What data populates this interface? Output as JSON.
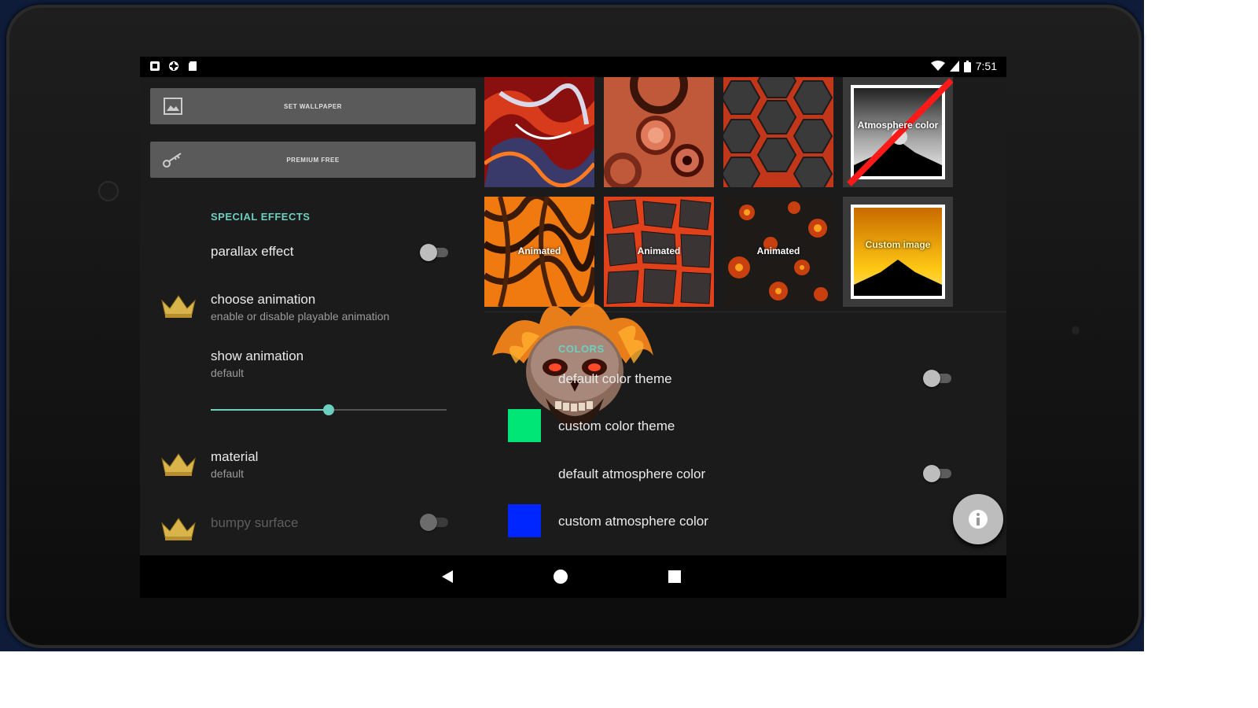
{
  "status_bar": {
    "left_icons": [
      "photo-icon",
      "android-icon",
      "sd-card-icon"
    ],
    "right_icons": [
      "wifi-icon",
      "signal-icon",
      "battery-icon"
    ],
    "time": "7:51"
  },
  "left_panel": {
    "buttons": [
      {
        "label": "SET WALLPAPER",
        "icon": "image-icon"
      },
      {
        "label": "PREMIUM FREE",
        "icon": "key-icon"
      }
    ],
    "section_title": "SPECIAL EFFECTS",
    "parallax": {
      "title": "parallax effect",
      "enabled": false
    },
    "choose_animation": {
      "title": "choose animation",
      "summary": "enable or disable playable animation",
      "premium": true
    },
    "show_animation": {
      "title": "show animation",
      "summary": "default",
      "slider_value": 0.5
    },
    "material": {
      "title": "material",
      "summary": "default",
      "premium": true
    },
    "bumpy_surface": {
      "title": "bumpy surface",
      "enabled": false,
      "premium": true
    }
  },
  "texture_grid": {
    "tiles": [
      {
        "label": "",
        "name": "texture-red-liquid-metal"
      },
      {
        "label": "",
        "name": "texture-copper-rings"
      },
      {
        "label": "",
        "name": "texture-hex-lava"
      },
      {
        "label": "Atmosphere color",
        "name": "texture-atmosphere-color"
      },
      {
        "label": "Animated",
        "name": "texture-animated-orange-lava"
      },
      {
        "label": "Animated",
        "name": "texture-animated-lava-rock"
      },
      {
        "label": "Animated",
        "name": "texture-animated-ember"
      },
      {
        "label": "Custom image",
        "name": "texture-custom-image"
      }
    ]
  },
  "colors_panel": {
    "section_title": "COLORS",
    "default_color_theme": {
      "title": "default color theme",
      "enabled": false
    },
    "custom_color_theme": {
      "title": "custom color theme",
      "color": "#00e676"
    },
    "default_atmosphere_color": {
      "title": "default atmosphere color",
      "enabled": false
    },
    "custom_atmosphere_color": {
      "title": "custom atmosphere color",
      "color": "#0026ff"
    }
  },
  "fab": {
    "icon": "info-icon"
  },
  "nav_bar": {
    "buttons": [
      "back-icon",
      "home-icon",
      "recents-icon"
    ]
  },
  "colors": {
    "accent": "#6dcfc0",
    "background": "#1b1b1b",
    "button": "#5a5a5a"
  }
}
